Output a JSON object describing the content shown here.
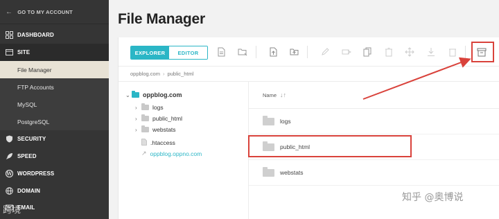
{
  "sidebar": {
    "go_back_label": "GO TO MY ACCOUNT",
    "items": [
      {
        "label": "DASHBOARD",
        "icon": "grid-icon"
      },
      {
        "label": "SITE",
        "icon": "site-icon"
      },
      {
        "label": "SECURITY",
        "icon": "shield-icon"
      },
      {
        "label": "SPEED",
        "icon": "rocket-icon"
      },
      {
        "label": "WORDPRESS",
        "icon": "wordpress-icon"
      },
      {
        "label": "DOMAIN",
        "icon": "globe-icon"
      },
      {
        "label": "EMAIL",
        "icon": "mail-icon"
      }
    ],
    "site_subitems": [
      "File Manager",
      "FTP Accounts",
      "MySQL",
      "PostgreSQL"
    ],
    "overlay_text": "跨境"
  },
  "main": {
    "title": "File Manager",
    "tabs": {
      "explorer": "EXPLORER",
      "editor": "EDITOR"
    },
    "breadcrumb": [
      "oppblog.com",
      "public_html"
    ]
  },
  "tree": {
    "root": "oppblog.com",
    "folders": [
      "logs",
      "public_html",
      "webstats"
    ],
    "file": ".htaccess",
    "symlink": "oppblog.oppno.com"
  },
  "files": {
    "column_name": "Name",
    "rows": [
      "logs",
      "public_html",
      "webstats"
    ]
  },
  "watermark": "知乎 @奥博说",
  "colors": {
    "accent": "#2bb6c6",
    "highlight": "#d9423b",
    "sidebar": "#353535"
  }
}
